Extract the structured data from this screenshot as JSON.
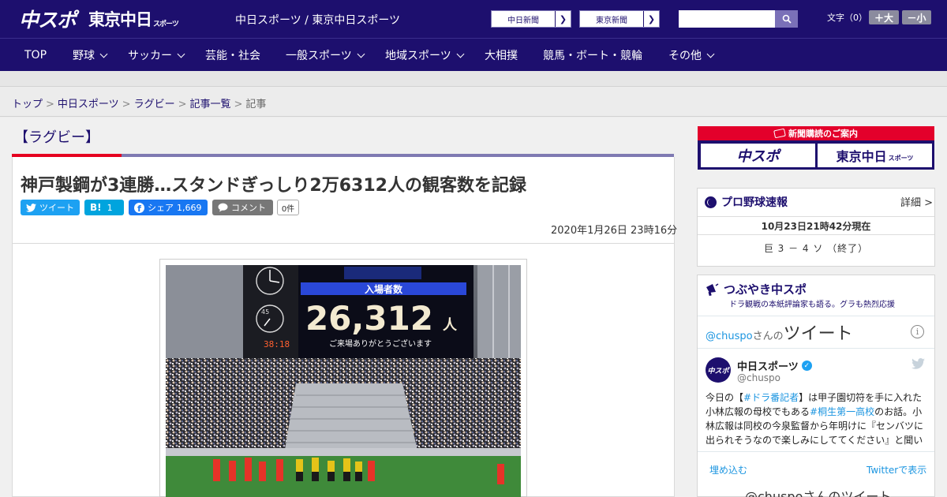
{
  "header": {
    "logo_chuspo": "中スポ",
    "logo_tokyo": "東京中日",
    "logo_tokyo_sub": "スポーツ",
    "site_names": "中日スポーツ / 東京中日スポーツ",
    "newspaper_links": [
      "中日新聞",
      "東京新聞"
    ],
    "search_placeholder": "",
    "font_size_label": "文字（0）",
    "font_larger": "＋大",
    "font_smaller": "－小"
  },
  "nav": {
    "items": [
      {
        "label": "TOP"
      },
      {
        "label": "野球"
      },
      {
        "label": "サッカー"
      },
      {
        "label": "芸能・社会"
      },
      {
        "label": "一般スポーツ"
      },
      {
        "label": "地域スポーツ"
      },
      {
        "label": "大相撲"
      },
      {
        "label": "競馬・ボート・競輪"
      },
      {
        "label": "その他"
      }
    ]
  },
  "breadcrumb": {
    "items": [
      "トップ",
      "中日スポーツ",
      "ラグビー",
      "記事一覧"
    ],
    "current": "記事",
    "separator": ">"
  },
  "article": {
    "category": "【ラグビー】",
    "title": "神戸製鋼が3連勝…スタンドぎっしり2万6312人の観客数を記録",
    "share": {
      "tweet": "ツイート",
      "hatena_logo": "B!",
      "hatena_count": "1",
      "facebook": "シェア",
      "facebook_count": "1,669",
      "comment": "コメント",
      "comment_count": "0件"
    },
    "date": "2020年1月26日 23時16分",
    "photo": {
      "scoreboard_label": "入場者数",
      "attendance": "26,312",
      "unit": "人",
      "thanks": "ご来場ありがとうございます",
      "clock_time": "38:18",
      "clock_minutes": "45"
    }
  },
  "sidebar": {
    "promo_title": "新聞購読のご案内",
    "promo_buttons": [
      "中スポ",
      "東京中日"
    ],
    "promo_button_sub": "スポーツ",
    "baseball": {
      "title": "プロ野球速報",
      "detail": "詳細 >",
      "timestamp": "10月23日21時42分現在",
      "score": "巨 3 － 4 ソ （終了）"
    },
    "tweets": {
      "title": "つぶやき中スポ",
      "subtitle": "ドラ観戦の本紙評論家も語る。グラも熱烈応援",
      "handle": "@chuspo",
      "handle_suffix": "さんの",
      "handle_big": "ツイート",
      "avatar_text": "中スポ",
      "account_name": "中日スポーツ",
      "account_user": "@chuspo",
      "text_pre": "今日の【",
      "text_tag1": "#ドラ番記者",
      "text_mid1": "】は甲子園切符を手に入れた小林広報の母校でもある",
      "text_tag2": "#桐生第一高校",
      "text_mid2": "のお話。小林広報は同校の今泉監督から年明けに『センバツに出られそうなので楽しみにしててください』と聞いていました",
      "embed": "埋め込む",
      "view": "Twitterで表示",
      "more": "@chuspoさんのツイート"
    }
  },
  "colors": {
    "brand_navy": "#1d0f6e",
    "accent_red": "#e50020",
    "twitter_blue": "#1da1f2",
    "facebook_blue": "#1877f2"
  }
}
